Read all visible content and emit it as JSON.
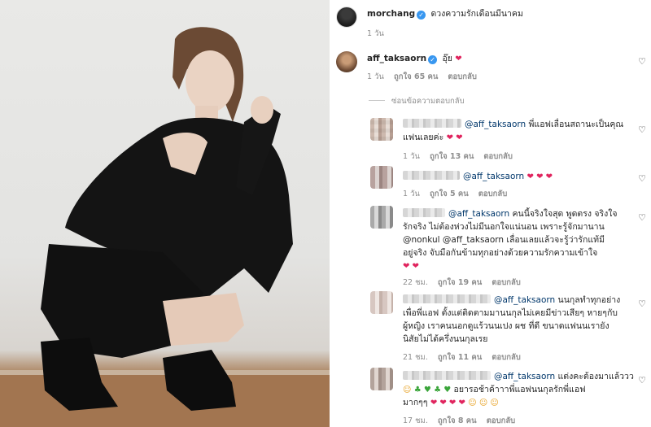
{
  "post": {
    "author": "morchang",
    "caption": "ดวงความรักเดือนมีนาคม",
    "time": "1 วัน"
  },
  "top_comment": {
    "username": "aff_taksaorn",
    "text": "อุ๊ย",
    "emoji": "❤",
    "time": "1 วัน",
    "likes": "ถูกใจ 65 คน",
    "reply": "ตอบกลับ"
  },
  "hide_replies": "ซ่อนข้อความตอบกลับ",
  "replies": [
    {
      "mention": "@aff_taksaorn",
      "lines": [
        "พี่แอฟเลื่อนสถานะเป็นคุณ",
        "แฟนเลยค่ะ"
      ],
      "trail": "❤ ❤",
      "time": "1 วัน",
      "likes": "ถูกใจ 13 คน",
      "reply": "ตอบกลับ"
    },
    {
      "mention": "@aff_taksaorn",
      "lines": [
        ""
      ],
      "trail": "❤ ❤ ❤",
      "time": "1 วัน",
      "likes": "ถูกใจ 5 คน",
      "reply": "ตอบกลับ"
    },
    {
      "mention": "@aff_taksaorn",
      "lines": [
        "คนนี้จริงใจสุด พูดตรง จริงใจ",
        "รักจริง ไม่ต้องห่วงไม่มีนอกใจแน่นอน เพราะรู้จักมานาน",
        "@nonkul @aff_taksaorn เลื่อนเลยแล้วจะรู้ว่ารักแท้มี",
        "อยู่จริง จับมือกันข้ามทุกอย่างด้วยความรักความเข้าใจ"
      ],
      "trail": "❤ ❤",
      "time": "22 ชม.",
      "likes": "ถูกใจ 19 คน",
      "reply": "ตอบกลับ"
    },
    {
      "mention": "@aff_taksaorn",
      "lines": [
        "นนกุลทำทุกอย่าง",
        "เพื่อพี่แอฟ ตั้งแต่ติดตามมานนกุลไม่เคยมีข่าวเสียๆ หายๆกับ",
        "ผู้หญิง เราคนนอกดูแร้วนนเปง ผช ที่ดี ขนาดแฟนนเรายัง",
        "นิสัยไม่ได้ครึ่งนนกุลเรย"
      ],
      "trail": "",
      "time": "21 ชม.",
      "likes": "ถูกใจ 11 คน",
      "reply": "ตอบกลับ"
    },
    {
      "mention": "@aff_taksaorn",
      "lines": [
        "แต่งคะต้องมาแล้ววว",
        "อยารอช้าค้าาาพี่แอฟนนกุลรักพี่แอฟ",
        "มากๆๆ"
      ],
      "trail": "",
      "time": "17 ชม.",
      "likes": "ถูกใจ 8 คน",
      "reply": "ตอบกลับ"
    }
  ],
  "icons": {
    "verified": "verified-badge-icon",
    "like": "heart-outline-icon"
  },
  "colors": {
    "mention": "#00376b",
    "verified": "#3897f0",
    "muted": "#8e8e8e"
  }
}
